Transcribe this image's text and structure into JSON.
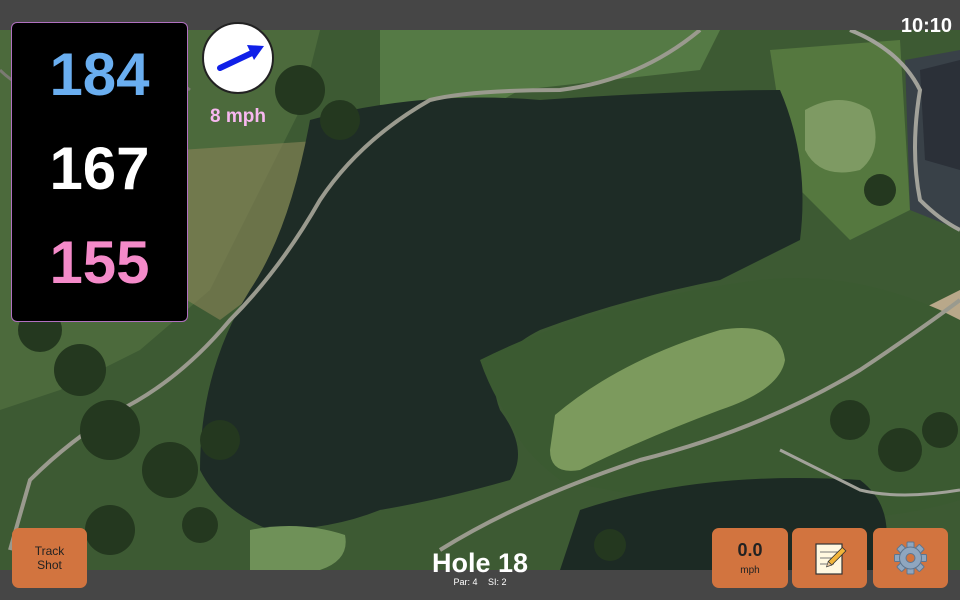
{
  "status": {
    "clock": "10:10"
  },
  "yardage": {
    "back": {
      "value": "184",
      "color": "#6aaef0"
    },
    "middle": {
      "value": "167",
      "color": "#ffffff"
    },
    "front": {
      "value": "155",
      "color": "#f48ac9"
    }
  },
  "wind": {
    "speed_label": "8 mph",
    "speed_color": "#f8b8f0",
    "arrow_color": "#1020e8",
    "icon": "wind-direction-arrow"
  },
  "buttons": {
    "track_shot": {
      "line1": "Track",
      "line2": "Shot"
    },
    "speed": {
      "value": "0.0",
      "unit": "mph"
    },
    "notes": {
      "icon": "notepad-icon"
    },
    "settings": {
      "icon": "gear-icon"
    },
    "accent": "#d2743f"
  },
  "hole": {
    "title": "Hole 18",
    "par": "Par: 4",
    "si": "SI: 2"
  }
}
